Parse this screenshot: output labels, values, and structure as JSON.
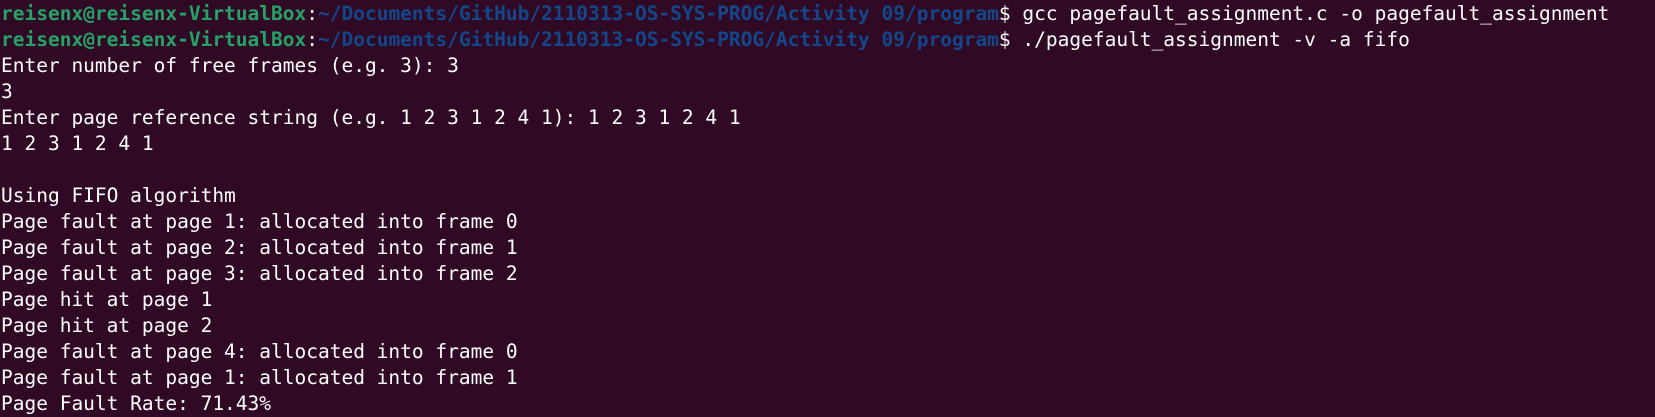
{
  "colors": {
    "background": "#300a24",
    "user_host": "#26a269",
    "path": "#12488b",
    "text": "#ffffff"
  },
  "prompts": [
    {
      "user_host": "reisenx@reisenx-VirtualBox",
      "separator": ":",
      "path": "~/Documents/GitHub/2110313-OS-SYS-PROG/Activity 09/program",
      "dollar": "$",
      "command": " gcc pagefault_assignment.c -o pagefault_assignment"
    },
    {
      "user_host": "reisenx@reisenx-VirtualBox",
      "separator": ":",
      "path": "~/Documents/GitHub/2110313-OS-SYS-PROG/Activity 09/program",
      "dollar": "$",
      "command": " ./pagefault_assignment -v -a fifo"
    }
  ],
  "output": [
    "Enter number of free frames (e.g. 3): 3",
    "3",
    "Enter page reference string (e.g. 1 2 3 1 2 4 1): 1 2 3 1 2 4 1",
    "1 2 3 1 2 4 1",
    "",
    "Using FIFO algorithm",
    "Page fault at page 1: allocated into frame 0",
    "Page fault at page 2: allocated into frame 1",
    "Page fault at page 3: allocated into frame 2",
    "Page hit at page 1",
    "Page hit at page 2",
    "Page fault at page 4: allocated into frame 0",
    "Page fault at page 1: allocated into frame 1",
    "Page Fault Rate: 71.43%"
  ]
}
